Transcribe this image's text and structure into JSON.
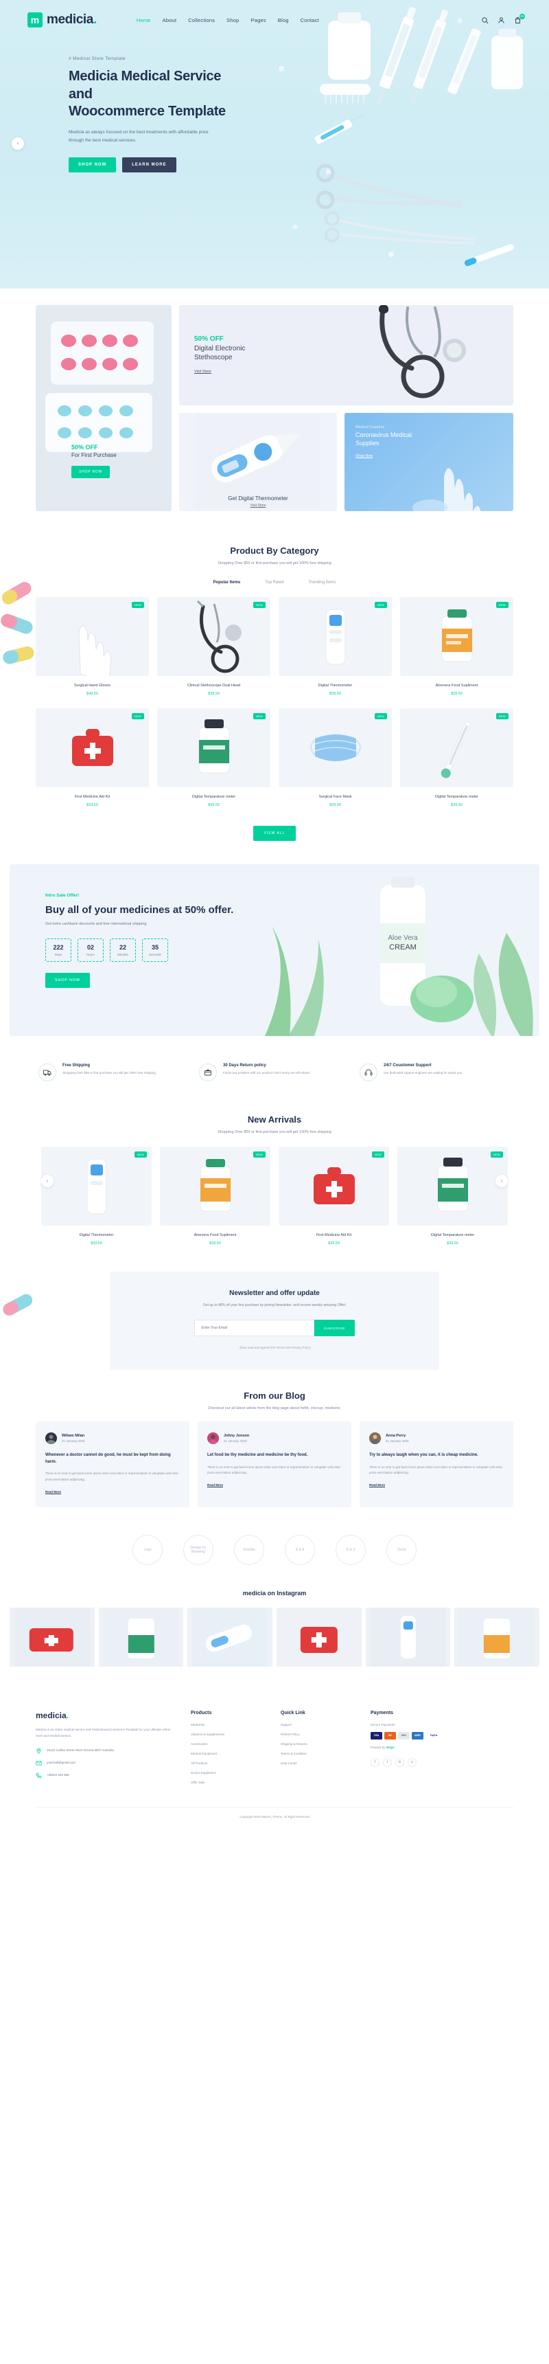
{
  "header": {
    "logo": "medicia",
    "logo_mark": "m",
    "logo_dot": ".",
    "nav": [
      {
        "label": "Home",
        "active": true
      },
      {
        "label": "About",
        "active": false
      },
      {
        "label": "Collections",
        "active": false
      },
      {
        "label": "Shop",
        "active": false
      },
      {
        "label": "Pages",
        "active": false
      },
      {
        "label": "Blog",
        "active": false
      },
      {
        "label": "Contact",
        "active": false
      }
    ],
    "cart_count": "03"
  },
  "hero": {
    "kicker": "# Medical Store Template",
    "title_line1": "Medicia Medical Service and",
    "title_line2": "Woocommerce Template",
    "subtitle": "Medicia as always focused on the best treatments with affordable price through the best medical services.",
    "btn_primary": "SHOP NOW",
    "btn_secondary": "LEARN MORE",
    "prev_arrow": "‹"
  },
  "promos": {
    "left": {
      "off": "50% OFF",
      "title": "For First Purchase",
      "button": "SHOP NOW"
    },
    "stethoscope": {
      "off": "50% OFF",
      "title_line1": "Digital Electronic",
      "title_line2": "Stethoscope",
      "link": "Visit Store"
    },
    "thermometer": {
      "title": "Get Digital Thermometer",
      "link": "Visit Store"
    },
    "corona": {
      "kicker": "Medical Supplies",
      "title_line1": "Coronavirus Medical",
      "title_line2": "Supplies",
      "link": "Shop Now"
    }
  },
  "category": {
    "title": "Product By Category",
    "subtitle": "Shopping Over $59 or first purchase you will get 100% free shipping",
    "tabs": [
      {
        "label": "Popular Items",
        "active": true
      },
      {
        "label": "Top Rated",
        "active": false
      },
      {
        "label": "Trending Items",
        "active": false
      }
    ],
    "view_all": "VIEW ALL",
    "products": [
      {
        "name": "Surgical Hand Gloves",
        "price": "$49.50",
        "badge": "NEW"
      },
      {
        "name": "Clinical Stethoscope Dual Head",
        "price": "$39.50",
        "badge": "NEW"
      },
      {
        "name": "Digital Thermometer",
        "price": "$39.50",
        "badge": "NEW"
      },
      {
        "name": "Aloevera Food Supliment",
        "price": "$39.50",
        "badge": "NEW"
      },
      {
        "name": "First Medicine Aid Kit",
        "price": "$29.50",
        "badge": "NEW"
      },
      {
        "name": "Digital Temparature meter",
        "price": "$39.00",
        "badge": "NEW"
      },
      {
        "name": "Surgical Face Mask",
        "price": "$39.00",
        "badge": "NEW"
      },
      {
        "name": "Digital Temparature meter",
        "price": "$39.50",
        "badge": "NEW"
      }
    ]
  },
  "sale": {
    "kicker": "Intro Sale Offer!",
    "title": "Buy all of your medicines at 50% offer.",
    "subtitle": "Get extra cashback discounts and free international shipping.",
    "counter": [
      {
        "value": "222",
        "label": "Days"
      },
      {
        "value": "02",
        "label": "Hours"
      },
      {
        "value": "22",
        "label": "Minutes"
      },
      {
        "value": "35",
        "label": "Seconds"
      }
    ],
    "button": "SHOP NOW"
  },
  "features": [
    {
      "title": "Free Shipping",
      "desc": "Shopping Over $59 or first purchase you will get 100% free shipping.",
      "icon": "truck-icon"
    },
    {
      "title": "30 Days Return policy",
      "desc": "Faces any problem with our product? don't worry we will refund.",
      "icon": "return-box-icon"
    },
    {
      "title": "24/7 Coustomer Support",
      "desc": "Our dedicated support engineer are waiting for assist you.",
      "icon": "headset-icon"
    }
  ],
  "arrivals": {
    "title": "New Arrivals",
    "subtitle": "Shopping Over $59 or first purchase you will get 100% free shipping",
    "prev_arrow": "‹",
    "next_arrow": "›",
    "products": [
      {
        "name": "Digital Thermometer",
        "price": "$39.50",
        "badge": "NEW"
      },
      {
        "name": "Aloevera Food Supliment",
        "price": "$39.50",
        "badge": "NEW"
      },
      {
        "name": "First Medicine Aid Kit",
        "price": "$39.50",
        "badge": "NEW"
      },
      {
        "name": "Digital Temparature meter",
        "price": "$39.50",
        "badge": "NEW"
      }
    ]
  },
  "newsletter": {
    "title": "Newsletter and offer update",
    "subtitle": "Get up to 48% off your first purchase by joining Newsletter, and receive weekly amazing Offer!",
    "placeholder": "Enter Your Email",
    "button": "SUBSCRIBE",
    "note": "I have read and agreed the Terms and Privacy Policy"
  },
  "blog": {
    "title": "From our Blog",
    "subtitle": "Checkout our all latest article from the blog page about helth, checup, medicine.",
    "posts": [
      {
        "author": "Wiliam Milan",
        "date": "21 January 2020",
        "title": "Whenever a doctor cannot do good, he must be kept from doing harm.",
        "excerpt": "There is no near to get back lorem ipsum dolor sure labor or representation in voluptate velit esse proto exercitation adipisicing.",
        "more": "Read More"
      },
      {
        "author": "Johny Jonson",
        "date": "21 January 2020",
        "title": "Let food be thy medicine and medicine be thy food.",
        "excerpt": "There is no near to get back lorem ipsum dolor sure labor or representation in voluptate velit esse proto exercitation adipisicing.",
        "more": "Read More"
      },
      {
        "author": "Anna Perry",
        "date": "21 January 2020",
        "title": "Try to always laugh when you can, it is cheap medicine.",
        "excerpt": "There is no near to get back lorem ipsum dolor sure labor or representation in voluptate velit esse proto exercitation adipisicing.",
        "more": "Read More"
      }
    ]
  },
  "brands": [
    {
      "label": "Logo"
    },
    {
      "label": "Design for Branding"
    },
    {
      "label": "Estrella"
    },
    {
      "label": "D & A"
    },
    {
      "label": "D & S"
    },
    {
      "label": "Circle"
    }
  ],
  "instagram": {
    "title": "medicia on Instagram"
  },
  "footer": {
    "logo": "medicia",
    "logo_dot": ".",
    "about": "Medicia is an online medical service and medicinewooCommerce Template for your ultimate online store and medical service.",
    "address": "16122 Collins Street West Victoria 8007 Australia",
    "email": "yourmail@gmail.com",
    "phone": "+88022 533 655",
    "columns": [
      {
        "title": "Products",
        "links": [
          "Medicines",
          "Vitamins & Supplements",
          "Accessories",
          "Medical Equipment",
          "All Products",
          "Doctor Equipment",
          "Offer Sale"
        ]
      },
      {
        "title": "Quick Link",
        "links": [
          "Support",
          "Refund Policy",
          "Shipping & Returns",
          "Teams & Condition",
          "Help Center"
        ]
      }
    ],
    "payments": {
      "title": "Payments",
      "secure_label": "Secure Payments",
      "methods": [
        "VISA",
        "MC",
        "DISC",
        "AMEX",
        "PayPal"
      ],
      "powered_prefix": "Powerd by ",
      "powered_brand": "stripe",
      "socials": [
        "f",
        "t",
        "in",
        "p"
      ]
    },
    "copyright": "Copyright 2020 Marvel_Theme. All Right Reserved"
  }
}
